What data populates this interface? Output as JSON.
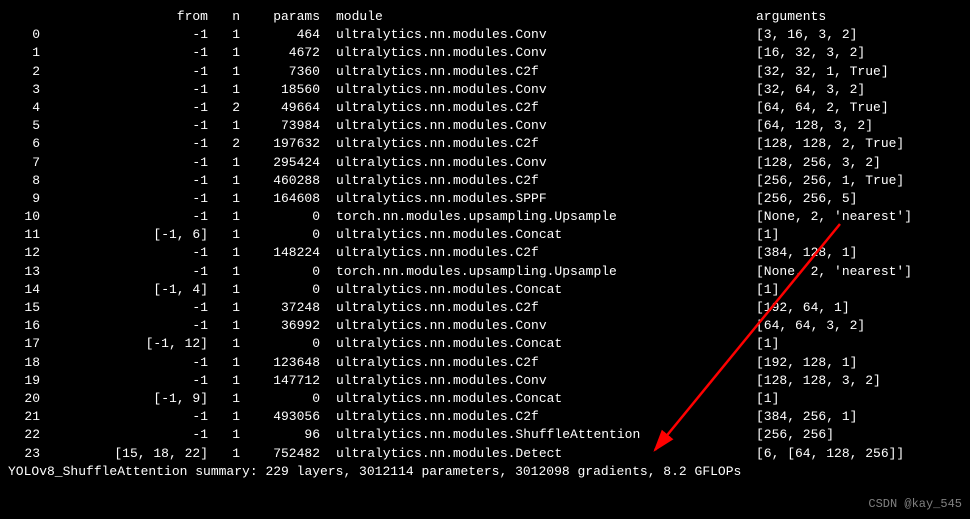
{
  "headers": {
    "idx": "",
    "from": "from",
    "n": "n",
    "params": "params",
    "module": "module",
    "args": "arguments"
  },
  "rows": [
    {
      "idx": "0",
      "from": "-1",
      "n": "1",
      "params": "464",
      "module": "ultralytics.nn.modules.Conv",
      "args": "[3, 16, 3, 2]"
    },
    {
      "idx": "1",
      "from": "-1",
      "n": "1",
      "params": "4672",
      "module": "ultralytics.nn.modules.Conv",
      "args": "[16, 32, 3, 2]"
    },
    {
      "idx": "2",
      "from": "-1",
      "n": "1",
      "params": "7360",
      "module": "ultralytics.nn.modules.C2f",
      "args": "[32, 32, 1, True]"
    },
    {
      "idx": "3",
      "from": "-1",
      "n": "1",
      "params": "18560",
      "module": "ultralytics.nn.modules.Conv",
      "args": "[32, 64, 3, 2]"
    },
    {
      "idx": "4",
      "from": "-1",
      "n": "2",
      "params": "49664",
      "module": "ultralytics.nn.modules.C2f",
      "args": "[64, 64, 2, True]"
    },
    {
      "idx": "5",
      "from": "-1",
      "n": "1",
      "params": "73984",
      "module": "ultralytics.nn.modules.Conv",
      "args": "[64, 128, 3, 2]"
    },
    {
      "idx": "6",
      "from": "-1",
      "n": "2",
      "params": "197632",
      "module": "ultralytics.nn.modules.C2f",
      "args": "[128, 128, 2, True]"
    },
    {
      "idx": "7",
      "from": "-1",
      "n": "1",
      "params": "295424",
      "module": "ultralytics.nn.modules.Conv",
      "args": "[128, 256, 3, 2]"
    },
    {
      "idx": "8",
      "from": "-1",
      "n": "1",
      "params": "460288",
      "module": "ultralytics.nn.modules.C2f",
      "args": "[256, 256, 1, True]"
    },
    {
      "idx": "9",
      "from": "-1",
      "n": "1",
      "params": "164608",
      "module": "ultralytics.nn.modules.SPPF",
      "args": "[256, 256, 5]"
    },
    {
      "idx": "10",
      "from": "-1",
      "n": "1",
      "params": "0",
      "module": "torch.nn.modules.upsampling.Upsample",
      "args": "[None, 2, 'nearest']"
    },
    {
      "idx": "11",
      "from": "[-1, 6]",
      "n": "1",
      "params": "0",
      "module": "ultralytics.nn.modules.Concat",
      "args": "[1]"
    },
    {
      "idx": "12",
      "from": "-1",
      "n": "1",
      "params": "148224",
      "module": "ultralytics.nn.modules.C2f",
      "args": "[384, 128, 1]"
    },
    {
      "idx": "13",
      "from": "-1",
      "n": "1",
      "params": "0",
      "module": "torch.nn.modules.upsampling.Upsample",
      "args": "[None, 2, 'nearest']"
    },
    {
      "idx": "14",
      "from": "[-1, 4]",
      "n": "1",
      "params": "0",
      "module": "ultralytics.nn.modules.Concat",
      "args": "[1]"
    },
    {
      "idx": "15",
      "from": "-1",
      "n": "1",
      "params": "37248",
      "module": "ultralytics.nn.modules.C2f",
      "args": "[192, 64, 1]"
    },
    {
      "idx": "16",
      "from": "-1",
      "n": "1",
      "params": "36992",
      "module": "ultralytics.nn.modules.Conv",
      "args": "[64, 64, 3, 2]"
    },
    {
      "idx": "17",
      "from": "[-1, 12]",
      "n": "1",
      "params": "0",
      "module": "ultralytics.nn.modules.Concat",
      "args": "[1]"
    },
    {
      "idx": "18",
      "from": "-1",
      "n": "1",
      "params": "123648",
      "module": "ultralytics.nn.modules.C2f",
      "args": "[192, 128, 1]"
    },
    {
      "idx": "19",
      "from": "-1",
      "n": "1",
      "params": "147712",
      "module": "ultralytics.nn.modules.Conv",
      "args": "[128, 128, 3, 2]"
    },
    {
      "idx": "20",
      "from": "[-1, 9]",
      "n": "1",
      "params": "0",
      "module": "ultralytics.nn.modules.Concat",
      "args": "[1]"
    },
    {
      "idx": "21",
      "from": "-1",
      "n": "1",
      "params": "493056",
      "module": "ultralytics.nn.modules.C2f",
      "args": "[384, 256, 1]"
    },
    {
      "idx": "22",
      "from": "-1",
      "n": "1",
      "params": "96",
      "module": "ultralytics.nn.modules.ShuffleAttention",
      "args": "[256, 256]"
    },
    {
      "idx": "23",
      "from": "[15, 18, 22]",
      "n": "1",
      "params": "752482",
      "module": "ultralytics.nn.modules.Detect",
      "args": "[6, [64, 128, 256]]"
    }
  ],
  "summary": "YOLOv8_ShuffleAttention summary: 229 layers, 3012114 parameters, 3012098 gradients, 8.2 GFLOPs",
  "watermark": "CSDN @kay_545",
  "arrow": {
    "color": "#ff0000"
  }
}
